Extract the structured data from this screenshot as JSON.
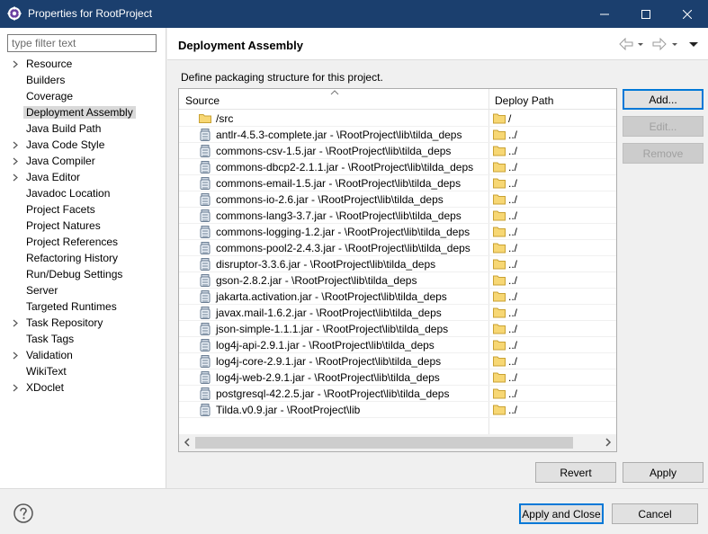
{
  "window": {
    "title": "Properties for RootProject"
  },
  "filter": {
    "placeholder": "type filter text",
    "value": ""
  },
  "tree": {
    "items": [
      {
        "label": "Resource",
        "expandable": true
      },
      {
        "label": "Builders",
        "expandable": false
      },
      {
        "label": "Coverage",
        "expandable": false
      },
      {
        "label": "Deployment Assembly",
        "expandable": false,
        "selected": true
      },
      {
        "label": "Java Build Path",
        "expandable": false
      },
      {
        "label": "Java Code Style",
        "expandable": true
      },
      {
        "label": "Java Compiler",
        "expandable": true
      },
      {
        "label": "Java Editor",
        "expandable": true
      },
      {
        "label": "Javadoc Location",
        "expandable": false
      },
      {
        "label": "Project Facets",
        "expandable": false
      },
      {
        "label": "Project Natures",
        "expandable": false
      },
      {
        "label": "Project References",
        "expandable": false
      },
      {
        "label": "Refactoring History",
        "expandable": false
      },
      {
        "label": "Run/Debug Settings",
        "expandable": false
      },
      {
        "label": "Server",
        "expandable": false
      },
      {
        "label": "Targeted Runtimes",
        "expandable": false
      },
      {
        "label": "Task Repository",
        "expandable": true
      },
      {
        "label": "Task Tags",
        "expandable": false
      },
      {
        "label": "Validation",
        "expandable": true
      },
      {
        "label": "WikiText",
        "expandable": false
      },
      {
        "label": "XDoclet",
        "expandable": true
      }
    ]
  },
  "page": {
    "title": "Deployment Assembly",
    "description": "Define packaging structure for this project."
  },
  "table": {
    "headers": {
      "source": "Source",
      "deploy_path": "Deploy Path"
    },
    "rows": [
      {
        "source": "/src",
        "kind": "folder",
        "path": "/"
      },
      {
        "source": "antlr-4.5.3-complete.jar - \\RootProject\\lib\\tilda_deps",
        "kind": "jar",
        "path": "../"
      },
      {
        "source": "commons-csv-1.5.jar - \\RootProject\\lib\\tilda_deps",
        "kind": "jar",
        "path": "../"
      },
      {
        "source": "commons-dbcp2-2.1.1.jar - \\RootProject\\lib\\tilda_deps",
        "kind": "jar",
        "path": "../"
      },
      {
        "source": "commons-email-1.5.jar - \\RootProject\\lib\\tilda_deps",
        "kind": "jar",
        "path": "../"
      },
      {
        "source": "commons-io-2.6.jar - \\RootProject\\lib\\tilda_deps",
        "kind": "jar",
        "path": "../"
      },
      {
        "source": "commons-lang3-3.7.jar - \\RootProject\\lib\\tilda_deps",
        "kind": "jar",
        "path": "../"
      },
      {
        "source": "commons-logging-1.2.jar - \\RootProject\\lib\\tilda_deps",
        "kind": "jar",
        "path": "../"
      },
      {
        "source": "commons-pool2-2.4.3.jar - \\RootProject\\lib\\tilda_deps",
        "kind": "jar",
        "path": "../"
      },
      {
        "source": "disruptor-3.3.6.jar - \\RootProject\\lib\\tilda_deps",
        "kind": "jar",
        "path": "../"
      },
      {
        "source": "gson-2.8.2.jar - \\RootProject\\lib\\tilda_deps",
        "kind": "jar",
        "path": "../"
      },
      {
        "source": "jakarta.activation.jar - \\RootProject\\lib\\tilda_deps",
        "kind": "jar",
        "path": "../"
      },
      {
        "source": "javax.mail-1.6.2.jar - \\RootProject\\lib\\tilda_deps",
        "kind": "jar",
        "path": "../"
      },
      {
        "source": "json-simple-1.1.1.jar - \\RootProject\\lib\\tilda_deps",
        "kind": "jar",
        "path": "../"
      },
      {
        "source": "log4j-api-2.9.1.jar - \\RootProject\\lib\\tilda_deps",
        "kind": "jar",
        "path": "../"
      },
      {
        "source": "log4j-core-2.9.1.jar - \\RootProject\\lib\\tilda_deps",
        "kind": "jar",
        "path": "../"
      },
      {
        "source": "log4j-web-2.9.1.jar - \\RootProject\\lib\\tilda_deps",
        "kind": "jar",
        "path": "../"
      },
      {
        "source": "postgresql-42.2.5.jar - \\RootProject\\lib\\tilda_deps",
        "kind": "jar",
        "path": "../"
      },
      {
        "source": "Tilda.v0.9.jar - \\RootProject\\lib",
        "kind": "jar",
        "path": "../"
      }
    ]
  },
  "buttons": {
    "add": "Add...",
    "edit": "Edit...",
    "remove": "Remove",
    "revert": "Revert",
    "apply": "Apply",
    "apply_close": "Apply and Close",
    "cancel": "Cancel"
  },
  "icons": {
    "app": "eclipse-gear-icon",
    "minimize": "minimize-icon",
    "maximize": "maximize-icon",
    "close": "close-icon",
    "back": "back-arrow-icon",
    "forward": "forward-arrow-icon",
    "menu": "view-menu-icon",
    "folder": "folder-icon",
    "jar": "jar-icon",
    "help": "help-icon"
  },
  "colors": {
    "titlebar": "#1b3f6e",
    "selection": "#d9d9d9",
    "folder": "#f2c94c",
    "default_button_border": "#0078d7"
  }
}
